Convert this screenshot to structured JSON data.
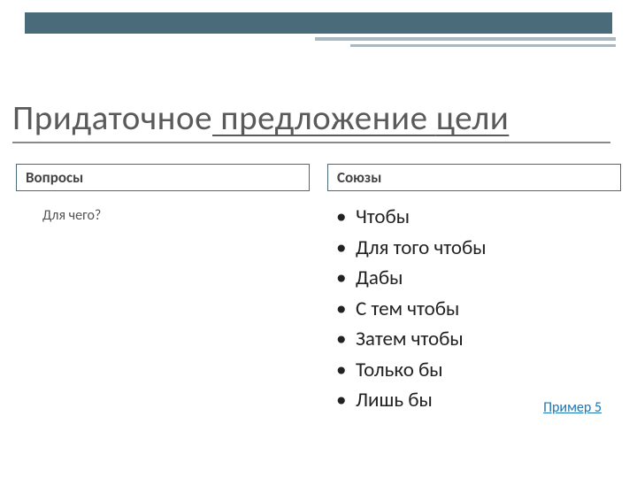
{
  "title": {
    "word1": "Придаточное",
    "word2": " предложение ",
    "word3": "цели"
  },
  "left": {
    "header": "Вопросы",
    "question": "Для чего?"
  },
  "right": {
    "header": "Союзы",
    "items": {
      "0": "Чтобы",
      "1": "Для того чтобы",
      "2": "Дабы",
      "3": "С тем чтобы",
      "4": "Затем чтобы",
      "5": "Только бы",
      "6": "Лишь бы"
    }
  },
  "link": "Пример 5"
}
